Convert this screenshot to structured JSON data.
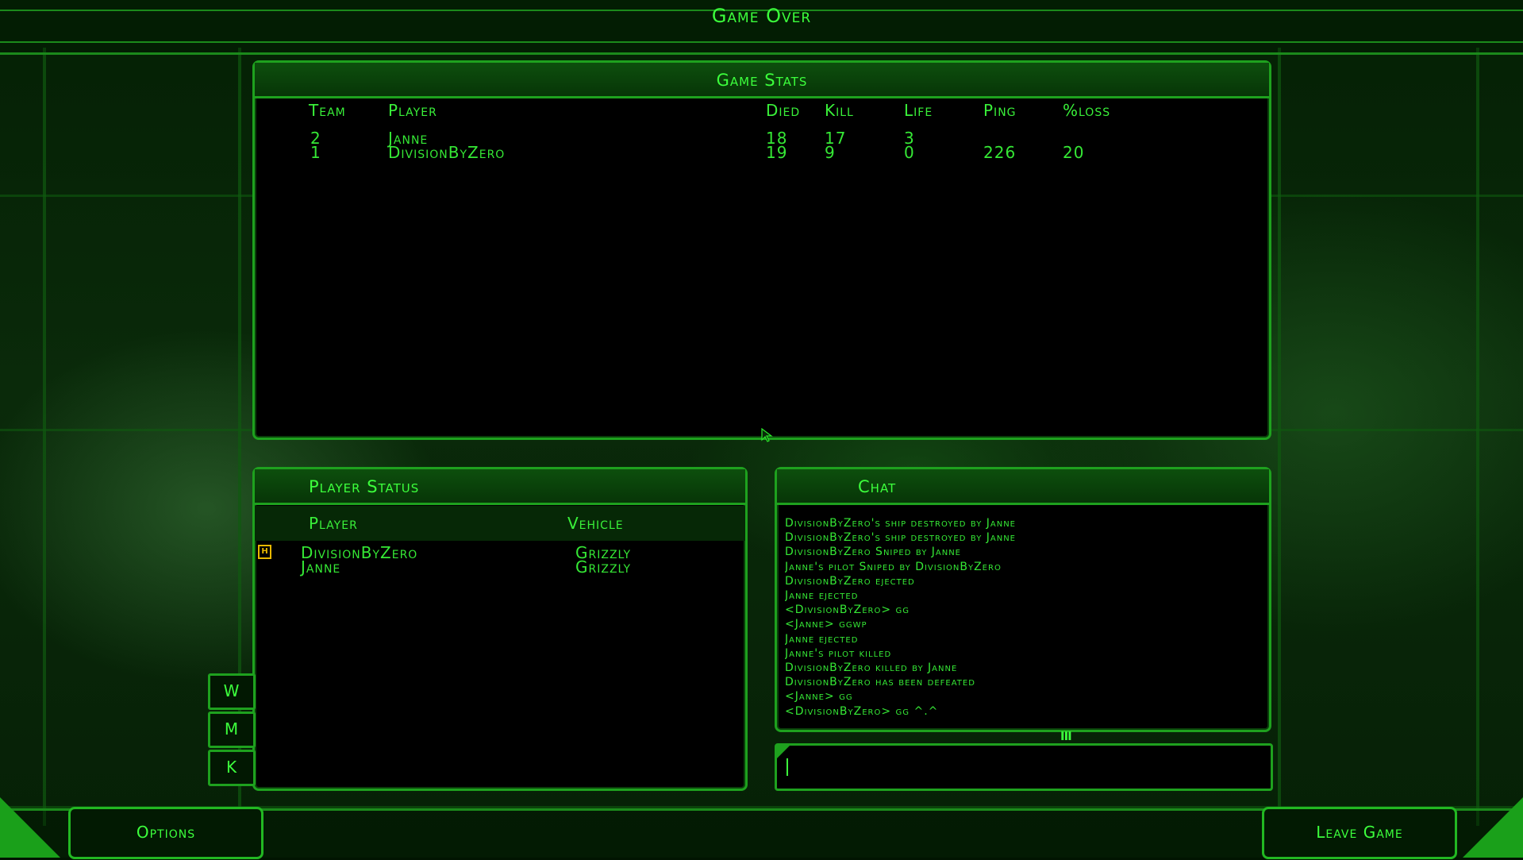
{
  "window": {
    "title": "Game Over"
  },
  "game_stats": {
    "title": "Game Stats",
    "columns": [
      "Team",
      "Player",
      "Died",
      "Kill",
      "Life",
      "Ping",
      "%loss"
    ],
    "rows": [
      {
        "team": "2",
        "player": "Janne",
        "died": "18",
        "kill": "17",
        "life": "3",
        "ping": "",
        "loss": ""
      },
      {
        "team": "1",
        "player": "DivisionByZero",
        "died": "19",
        "kill": "9",
        "life": "0",
        "ping": "226",
        "loss": "20"
      }
    ]
  },
  "player_status": {
    "title": "Player Status",
    "columns": {
      "player": "Player",
      "vehicle": "Vehicle"
    },
    "rows": [
      {
        "marker": "H",
        "player": "DivisionByZero",
        "vehicle": "Grizzly"
      },
      {
        "marker": "",
        "player": "Janne",
        "vehicle": "Grizzly"
      }
    ]
  },
  "side_buttons": [
    "W",
    "M",
    "K"
  ],
  "chat": {
    "title": "Chat",
    "lines": [
      "DivisionByZero's ship destroyed by  Janne",
      "DivisionByZero's ship destroyed by  Janne",
      "DivisionByZero Sniped by  Janne",
      "Janne's pilot  Sniped by  DivisionByZero",
      "DivisionByZero  ejected",
      "Janne  ejected",
      "<DivisionByZero> gg",
      "<Janne> ggwp",
      "Janne  ejected",
      "Janne's pilot   killed",
      "DivisionByZero  killed by  Janne",
      "DivisionByZero  has been defeated",
      "<Janne> gg",
      "<DivisionByZero> gg ^.^"
    ],
    "input_value": "",
    "resize_handle": "III"
  },
  "footer": {
    "options_label": "Options",
    "leave_label": "Leave Game"
  },
  "colors": {
    "accent": "#2bea2b",
    "panel_border": "#1ea11e",
    "marker": "#e8b800"
  }
}
